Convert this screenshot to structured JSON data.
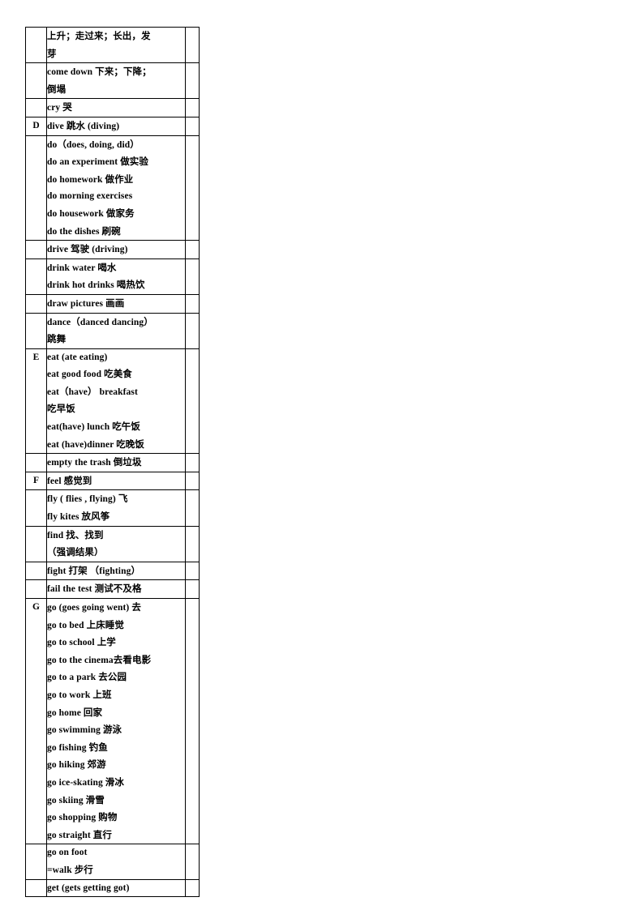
{
  "document": {
    "type": "vocabulary-table",
    "columns": [
      "letter",
      "entries",
      "notes"
    ]
  },
  "table": {
    "rows": [
      {
        "letter": "",
        "lines": [
          "上升；走过来；长出，发",
          "芽"
        ]
      },
      {
        "letter": "",
        "lines": [
          "come down  下来；下降；",
          "倒塌"
        ]
      },
      {
        "letter": "",
        "lines": [
          "cry  哭"
        ]
      },
      {
        "letter": "D",
        "lines": [
          "dive 跳水        (diving)"
        ]
      },
      {
        "letter": "",
        "lines": [
          "do（does, doing, did）",
          "do an experiment 做实验",
          "do homework 做作业",
          "do morning exercises",
          "do housework 做家务",
          "do the dishes  刷碗"
        ]
      },
      {
        "letter": "",
        "lines": [
          "drive 驾驶    (driving)"
        ]
      },
      {
        "letter": "",
        "lines": [
          "drink    water 喝水",
          "drink hot drinks  喝热饮"
        ]
      },
      {
        "letter": "",
        "lines": [
          "draw pictures 画画"
        ]
      },
      {
        "letter": "",
        "lines": [
          "dance（danced dancing）",
          "跳舞"
        ]
      },
      {
        "letter": "E",
        "lines": [
          "eat (ate    eating)",
          "eat good food  吃美食",
          "eat（have）  breakfast",
          "吃早饭",
          "eat(have) lunch  吃午饭",
          "eat (have)dinner 吃晚饭"
        ]
      },
      {
        "letter": "",
        "lines": [
          "empty the trash 倒垃圾"
        ]
      },
      {
        "letter": "F",
        "lines": [
          "feel 感觉到"
        ]
      },
      {
        "letter": "",
        "lines": [
          "fly ( flies , flying)  飞",
          "fly kites 放风筝"
        ]
      },
      {
        "letter": "",
        "lines": [
          "find 找、找到",
          "（强调结果）"
        ]
      },
      {
        "letter": "",
        "lines": [
          "fight 打架  （fighting）"
        ]
      },
      {
        "letter": "",
        "lines": [
          "fail the test  测试不及格"
        ]
      },
      {
        "letter": "G",
        "lines": [
          "go (goes going went)  去",
          "go to bed 上床睡觉",
          "go to school 上学",
          "go to the cinema去看电影",
          "go to a park  去公园",
          "go to work 上班",
          "go home  回家",
          "go swimming  游泳",
          "go fishing  钓鱼",
          "go hiking  郊游",
          "go ice-skating  滑冰",
          "go skiing  滑雪",
          "go shopping  购物",
          "go straight  直行"
        ]
      },
      {
        "letter": "",
        "lines": [
          "go on foot",
          "=walk 步行"
        ]
      },
      {
        "letter": "",
        "lines": [
          "get (gets    getting    got)"
        ]
      }
    ]
  }
}
